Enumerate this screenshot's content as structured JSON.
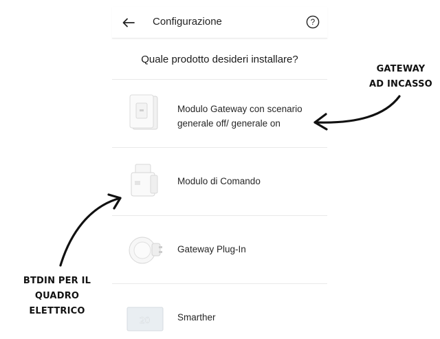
{
  "appbar": {
    "back_icon": "arrow-left-icon",
    "title": "Configurazione",
    "help_icon": "question-circle-icon"
  },
  "question": "Quale prodotto desideri installare?",
  "products": [
    {
      "label": "Modulo Gateway con scenario generale off/ generale on",
      "icon": "wall-switch-module-icon"
    },
    {
      "label": "Modulo di Comando",
      "icon": "din-rail-module-icon"
    },
    {
      "label": "Gateway Plug-In",
      "icon": "plug-in-gateway-icon"
    },
    {
      "label": "Smarther",
      "icon": "thermostat-icon",
      "display_text": "20"
    }
  ],
  "annotations": {
    "gateway_incasso": {
      "line1": "GATEWAY",
      "line2": "AD INCASSO"
    },
    "btdin": {
      "line1": "BTDIN PER IL",
      "line2": "QUADRO ELETTRICO"
    }
  },
  "colors": {
    "divider": "#e9e9e9",
    "text": "#262626",
    "annotation": "#111111"
  }
}
